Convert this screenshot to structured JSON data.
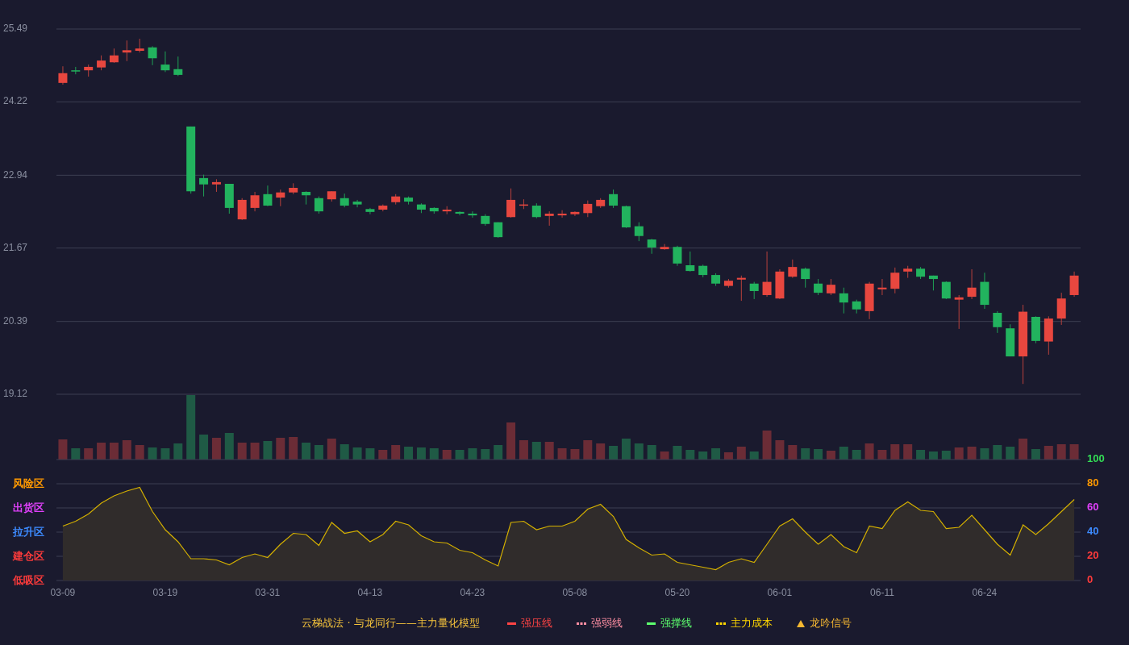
{
  "price_chart": {
    "chart_data": {
      "type": "candlestick",
      "grid": true,
      "ylim": [
        19.12,
        25.49
      ],
      "yticks": [
        {
          "value": 25.49,
          "label": "25.49"
        },
        {
          "value": 24.22,
          "label": "24.22"
        },
        {
          "value": 22.94,
          "label": "22.94"
        },
        {
          "value": 21.67,
          "label": "21.67"
        },
        {
          "value": 20.39,
          "label": "20.39"
        },
        {
          "value": 19.12,
          "label": "19.12"
        }
      ],
      "categories": [
        null,
        null,
        null,
        null,
        null,
        null,
        null,
        null,
        null,
        null,
        null,
        null,
        null,
        null,
        null,
        null,
        null,
        null,
        null,
        null,
        null,
        null,
        null,
        null,
        null,
        null,
        null,
        null,
        null,
        null,
        null,
        null,
        null,
        null,
        null,
        null,
        null,
        null,
        null,
        null,
        null,
        null,
        null,
        null,
        null,
        null,
        null,
        null,
        null,
        null,
        null,
        null,
        null,
        null,
        null,
        null,
        null,
        null,
        null,
        null,
        null,
        null,
        null,
        null,
        null,
        null,
        null,
        null,
        null,
        null,
        null,
        null,
        null,
        null,
        null,
        null,
        null,
        null,
        null,
        null
      ],
      "ohlc": [
        [
          24.55,
          24.84,
          24.52,
          24.72
        ],
        [
          24.77,
          24.83,
          24.7,
          24.76
        ],
        [
          24.77,
          24.87,
          24.66,
          24.83
        ],
        [
          24.82,
          25.03,
          24.77,
          24.94
        ],
        [
          24.91,
          25.15,
          24.9,
          25.03
        ],
        [
          25.08,
          25.29,
          24.93,
          25.12
        ],
        [
          25.11,
          25.32,
          25.08,
          25.15
        ],
        [
          25.17,
          25.19,
          24.86,
          24.98
        ],
        [
          24.87,
          25.1,
          24.74,
          24.77
        ],
        [
          24.79,
          25.01,
          24.67,
          24.69
        ],
        [
          23.79,
          23.79,
          22.62,
          22.66
        ],
        [
          22.89,
          22.95,
          22.57,
          22.78
        ],
        [
          22.78,
          22.87,
          22.65,
          22.82
        ],
        [
          22.79,
          22.79,
          22.27,
          22.37
        ],
        [
          22.17,
          22.54,
          22.16,
          22.51
        ],
        [
          22.37,
          22.65,
          22.31,
          22.59
        ],
        [
          22.61,
          22.76,
          22.4,
          22.41
        ],
        [
          22.55,
          22.69,
          22.4,
          22.64
        ],
        [
          22.64,
          22.8,
          22.61,
          22.72
        ],
        [
          22.65,
          22.66,
          22.43,
          22.59
        ],
        [
          22.54,
          22.57,
          22.27,
          22.31
        ],
        [
          22.52,
          22.66,
          22.48,
          22.66
        ],
        [
          22.54,
          22.62,
          22.38,
          22.41
        ],
        [
          22.48,
          22.51,
          22.38,
          22.43
        ],
        [
          22.35,
          22.37,
          22.26,
          22.3
        ],
        [
          22.34,
          22.43,
          22.31,
          22.41
        ],
        [
          22.47,
          22.61,
          22.43,
          22.57
        ],
        [
          22.55,
          22.57,
          22.43,
          22.48
        ],
        [
          22.43,
          22.45,
          22.28,
          22.34
        ],
        [
          22.37,
          22.38,
          22.27,
          22.31
        ],
        [
          22.31,
          22.4,
          22.26,
          22.34
        ],
        [
          22.3,
          22.31,
          22.24,
          22.27
        ],
        [
          22.27,
          22.31,
          22.2,
          22.24
        ],
        [
          22.23,
          22.26,
          22.06,
          22.09
        ],
        [
          22.12,
          22.12,
          21.85,
          21.86
        ],
        [
          22.21,
          22.71,
          22.2,
          22.51
        ],
        [
          22.41,
          22.52,
          22.35,
          22.43
        ],
        [
          22.41,
          22.45,
          22.19,
          22.21
        ],
        [
          22.23,
          22.31,
          22.06,
          22.27
        ],
        [
          22.24,
          22.33,
          22.2,
          22.27
        ],
        [
          22.26,
          22.31,
          22.23,
          22.3
        ],
        [
          22.28,
          22.5,
          22.21,
          22.44
        ],
        [
          22.4,
          22.54,
          22.37,
          22.51
        ],
        [
          22.61,
          22.69,
          22.37,
          22.41
        ],
        [
          22.4,
          22.41,
          22.02,
          22.03
        ],
        [
          22.05,
          22.12,
          21.79,
          21.88
        ],
        [
          21.82,
          21.83,
          21.57,
          21.68
        ],
        [
          21.65,
          21.74,
          21.64,
          21.69
        ],
        [
          21.69,
          21.71,
          21.36,
          21.4
        ],
        [
          21.37,
          21.61,
          21.26,
          21.27
        ],
        [
          21.36,
          21.38,
          21.16,
          21.2
        ],
        [
          21.2,
          21.23,
          21.01,
          21.05
        ],
        [
          21.01,
          21.13,
          20.98,
          21.1
        ],
        [
          21.12,
          21.19,
          20.75,
          21.15
        ],
        [
          21.05,
          21.08,
          20.78,
          20.92
        ],
        [
          20.85,
          21.61,
          20.82,
          21.08
        ],
        [
          20.79,
          21.3,
          20.78,
          21.26
        ],
        [
          21.17,
          21.47,
          21.15,
          21.34
        ],
        [
          21.31,
          21.33,
          20.98,
          21.13
        ],
        [
          21.05,
          21.13,
          20.85,
          20.89
        ],
        [
          20.88,
          21.13,
          20.85,
          21.03
        ],
        [
          20.88,
          20.98,
          20.53,
          20.72
        ],
        [
          20.74,
          20.77,
          20.53,
          20.6
        ],
        [
          20.57,
          21.08,
          20.43,
          21.05
        ],
        [
          20.95,
          21.13,
          20.85,
          20.98
        ],
        [
          20.96,
          21.33,
          20.88,
          21.24
        ],
        [
          21.26,
          21.36,
          21.15,
          21.31
        ],
        [
          21.31,
          21.34,
          21.13,
          21.17
        ],
        [
          21.19,
          21.19,
          20.93,
          21.13
        ],
        [
          21.08,
          21.09,
          20.78,
          20.79
        ],
        [
          20.77,
          20.85,
          20.26,
          20.81
        ],
        [
          20.82,
          21.3,
          20.78,
          20.98
        ],
        [
          21.08,
          21.24,
          20.61,
          20.68
        ],
        [
          20.54,
          20.57,
          20.19,
          20.29
        ],
        [
          20.27,
          20.34,
          19.78,
          19.78
        ],
        [
          19.78,
          20.68,
          19.3,
          20.56
        ],
        [
          20.47,
          20.48,
          20.01,
          20.05
        ],
        [
          20.04,
          20.48,
          19.81,
          20.44
        ],
        [
          20.44,
          20.89,
          20.33,
          20.79
        ],
        [
          20.85,
          21.26,
          20.82,
          21.19
        ]
      ]
    }
  },
  "indicator_panel": {
    "zones": [
      {
        "label": "风险区",
        "color": "#ff9900"
      },
      {
        "label": "出货区",
        "color": "#e040fb"
      },
      {
        "label": "拉升区",
        "color": "#3d8bff"
      },
      {
        "label": "建仓区",
        "color": "#ff3b3b"
      },
      {
        "label": "低吸区",
        "color": "#ff3b3b"
      }
    ],
    "axis_right": [
      {
        "label": "100",
        "color": "#33dd55"
      },
      {
        "label": "80",
        "color": "#ff9900"
      },
      {
        "label": "60",
        "color": "#e040fb"
      },
      {
        "label": "40",
        "color": "#3d8bff"
      },
      {
        "label": "20",
        "color": "#ff3b3b"
      },
      {
        "label": "0",
        "color": "#ff3b3b"
      }
    ],
    "chart_data": {
      "type": "area",
      "grid": true,
      "ylim": [
        0,
        100
      ],
      "yticks": [
        0,
        20,
        40,
        60,
        80,
        100
      ],
      "categories": [
        "03-09",
        null,
        null,
        null,
        null,
        null,
        null,
        null,
        "03-19",
        null,
        null,
        null,
        null,
        null,
        null,
        null,
        "03-31",
        null,
        null,
        null,
        null,
        null,
        null,
        null,
        "04-13",
        null,
        null,
        null,
        null,
        null,
        null,
        null,
        "04-23",
        null,
        null,
        null,
        null,
        null,
        null,
        null,
        "05-08",
        null,
        null,
        null,
        null,
        null,
        null,
        null,
        "05-20",
        null,
        null,
        null,
        null,
        null,
        null,
        null,
        "06-01",
        null,
        null,
        null,
        null,
        null,
        null,
        null,
        "06-11",
        null,
        null,
        null,
        null,
        null,
        null,
        null,
        "06-24",
        null,
        null,
        null,
        null,
        null,
        null,
        null
      ],
      "series": [
        {
          "color": "#d4b000",
          "values": [
            45,
            49,
            55,
            64,
            70,
            74,
            77,
            57,
            42,
            32,
            18,
            18,
            17,
            13,
            19,
            22,
            19,
            30,
            39,
            38,
            29,
            48,
            39,
            41,
            32,
            38,
            49,
            46,
            37,
            32,
            31,
            25,
            23,
            17,
            12,
            48,
            49,
            42,
            45,
            45,
            49,
            59,
            63,
            53,
            34,
            27,
            21,
            22,
            15,
            13,
            11,
            9,
            15,
            18,
            15,
            30,
            45,
            51,
            40,
            30,
            38,
            28,
            23,
            45,
            43,
            58,
            65,
            58,
            57,
            43,
            44,
            54,
            42,
            30,
            21,
            46,
            38,
            47,
            57,
            67
          ]
        }
      ]
    }
  },
  "legend": {
    "title": "云梯战法 · 与龙同行——主力量化模型",
    "items": [
      {
        "kind": "line",
        "label": "强压线",
        "color": "#ff4444"
      },
      {
        "kind": "dashed",
        "label": "强弱线",
        "color": "#ff8fa3"
      },
      {
        "kind": "line",
        "label": "强撑线",
        "color": "#5dff6e"
      },
      {
        "kind": "dashed",
        "label": "主力成本",
        "color": "#ffd700"
      },
      {
        "kind": "triangle",
        "label": "龙吟信号",
        "color": "#f5b731"
      }
    ]
  }
}
